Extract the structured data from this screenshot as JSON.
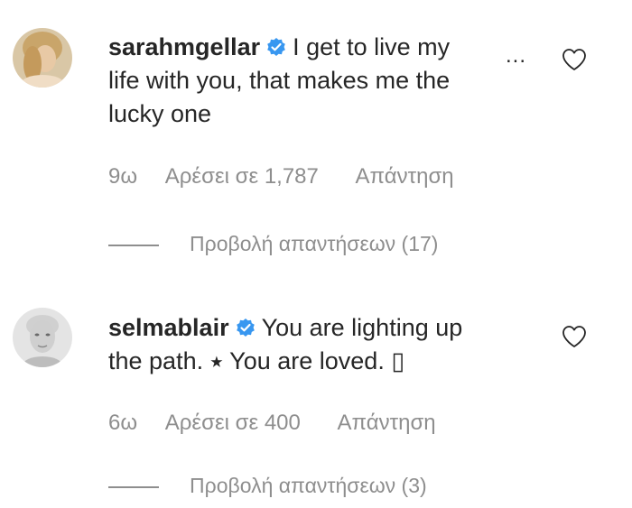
{
  "comments": [
    {
      "username": "sarahmgellar",
      "text_line1": "I get to live my",
      "text_line2": "life with you, that makes me the",
      "text_line3": "lucky one",
      "time": "9ω",
      "likes": "Αρέσει σε 1,787",
      "reply": "Απάντηση",
      "view_replies": "Προβολή απαντήσεων (17)",
      "more_options": "..."
    },
    {
      "username": "selmablair",
      "text_line1": "You are lighting up",
      "text_line2": "the path. ⭑ You are loved. ▯",
      "time": "6ω",
      "likes": "Αρέσει σε 400",
      "reply": "Απάντηση",
      "view_replies": "Προβολή απαντήσεων (3)"
    }
  ],
  "colors": {
    "text": "#262626",
    "secondary": "#8e8e8e",
    "verified_badge": "#3897f0"
  },
  "icons": {
    "verified": "verified-badge-icon",
    "like": "heart-outline-icon",
    "more": "ellipsis-icon"
  }
}
